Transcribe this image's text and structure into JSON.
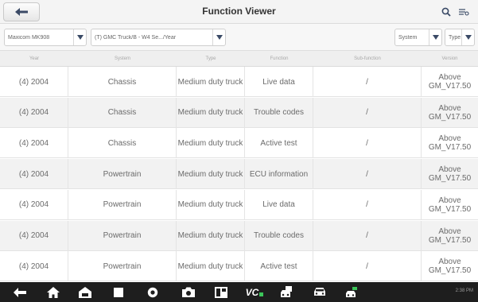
{
  "header": {
    "title": "Function Viewer"
  },
  "filters": {
    "model": "Maxicom MK908",
    "vehicle": "(T) GMC Truck/B - W4 Se.../Year",
    "system": "System",
    "type": "Type"
  },
  "columns": [
    "Year",
    "System",
    "Type",
    "Function",
    "Sub-function",
    "Version"
  ],
  "rows": [
    [
      "(4) 2004",
      "Chassis",
      "Medium duty truck",
      "Live data",
      "/",
      "Above GM_V17.50"
    ],
    [
      "(4) 2004",
      "Chassis",
      "Medium duty truck",
      "Trouble codes",
      "/",
      "Above GM_V17.50"
    ],
    [
      "(4) 2004",
      "Chassis",
      "Medium duty truck",
      "Active test",
      "/",
      "Above GM_V17.50"
    ],
    [
      "(4) 2004",
      "Powertrain",
      "Medium duty truck",
      "ECU information",
      "/",
      "Above GM_V17.50"
    ],
    [
      "(4) 2004",
      "Powertrain",
      "Medium duty truck",
      "Live data",
      "/",
      "Above GM_V17.50"
    ],
    [
      "(4) 2004",
      "Powertrain",
      "Medium duty truck",
      "Trouble codes",
      "/",
      "Above GM_V17.50"
    ],
    [
      "(4) 2004",
      "Powertrain",
      "Medium duty truck",
      "Active test",
      "/",
      "Above GM_V17.50"
    ]
  ],
  "navbar": {
    "icons": [
      "back-icon",
      "home-icon",
      "car-home-icon",
      "recent-apps-icon",
      "browser-icon",
      "camera-icon",
      "screen-icon",
      "vci-icon",
      "shop-icon",
      "vehicle-icon",
      "service-icon"
    ],
    "vc_label": "VC",
    "status_time": "2:38 PM"
  },
  "colors": {
    "nav_bg": "#1e1e1e",
    "alt_row": "#f2f2f2",
    "dropdown_arrow": "#3a4a66"
  }
}
